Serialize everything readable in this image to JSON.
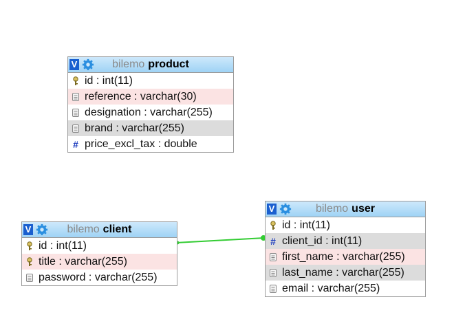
{
  "tables": {
    "product": {
      "db": "bilemo",
      "name": "product",
      "toggle": "V",
      "columns": [
        {
          "label": "id : int(11)",
          "icon": "key-icon"
        },
        {
          "label": "reference : varchar(30)",
          "icon": "field-icon"
        },
        {
          "label": "designation : varchar(255)",
          "icon": "field-icon"
        },
        {
          "label": "brand : varchar(255)",
          "icon": "field-icon"
        },
        {
          "label": "price_excl_tax : double",
          "icon": "hash-icon"
        }
      ]
    },
    "client": {
      "db": "bilemo",
      "name": "client",
      "toggle": "V",
      "columns": [
        {
          "label": "id : int(11)",
          "icon": "key-icon"
        },
        {
          "label": "title : varchar(255)",
          "icon": "key-icon"
        },
        {
          "label": "password : varchar(255)",
          "icon": "field-icon"
        }
      ]
    },
    "user": {
      "db": "bilemo",
      "name": "user",
      "toggle": "V",
      "columns": [
        {
          "label": "id : int(11)",
          "icon": "key-icon"
        },
        {
          "label": "client_id : int(11)",
          "icon": "hash-icon"
        },
        {
          "label": "first_name : varchar(255)",
          "icon": "field-icon"
        },
        {
          "label": "last_name : varchar(255)",
          "icon": "field-icon"
        },
        {
          "label": "email : varchar(255)",
          "icon": "field-icon"
        }
      ]
    }
  },
  "relation": {
    "from": "client.id",
    "to": "user.client_id",
    "color": "#33cc33"
  },
  "colors": {
    "header": "#9fd3f5",
    "toggle": "#1a5fcf",
    "highlight_pink": "#fbe3e3",
    "highlight_gray": "#dcdcdc"
  }
}
